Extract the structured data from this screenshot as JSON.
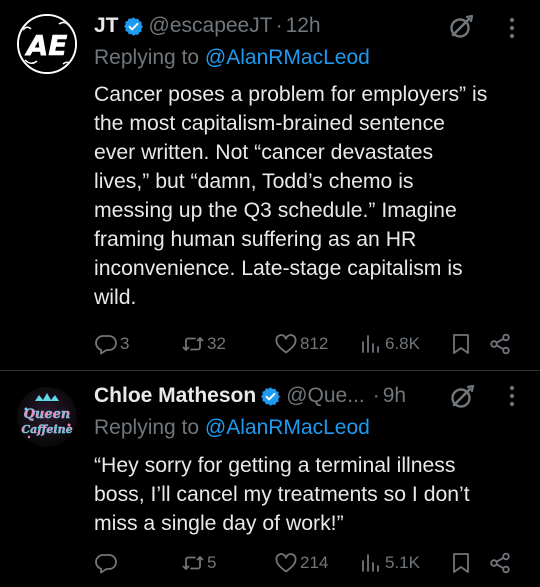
{
  "tweets": [
    {
      "avatar_text": "AE",
      "name": "JT",
      "handle": "@escapeeJT",
      "separator": "·",
      "time": "12h",
      "replying_prefix": "Replying to",
      "replying_to": "@AlanRMacLeod",
      "text_lines": [
        "Cancer poses a problem for employers” is",
        "the most capitalism-brained sentence",
        "ever written. Not “cancer devastates",
        "lives,” but “damn, Todd’s chemo is",
        "messing up the Q3 schedule.” Imagine",
        "framing human suffering as an HR",
        "inconvenience. Late-stage capitalism is",
        "wild."
      ],
      "replies": "3",
      "retweets": "32",
      "likes": "812",
      "views": "6.8K"
    },
    {
      "avatar_text": "Queen Caffeine",
      "name": "Chloe Matheson",
      "handle": "@Que...",
      "separator": "·",
      "time": "9h",
      "replying_prefix": "Replying to",
      "replying_to": "@AlanRMacLeod",
      "text_lines": [
        "“Hey sorry for getting a terminal illness",
        "boss, I’ll cancel my treatments so I don’t",
        "miss a single day of work!”"
      ],
      "replies": "",
      "retweets": "5",
      "likes": "214",
      "views": "5.1K"
    }
  ],
  "colors": {
    "background": "#000000",
    "text": "#e7e9ea",
    "muted": "#71767b",
    "link": "#1d9bf0",
    "verified": "#1d9bf0",
    "divider": "#2f3336"
  },
  "icons": [
    "verified-badge-icon",
    "grok-icon",
    "more-icon",
    "reply-icon",
    "retweet-icon",
    "like-icon",
    "views-icon",
    "bookmark-icon",
    "share-icon"
  ]
}
